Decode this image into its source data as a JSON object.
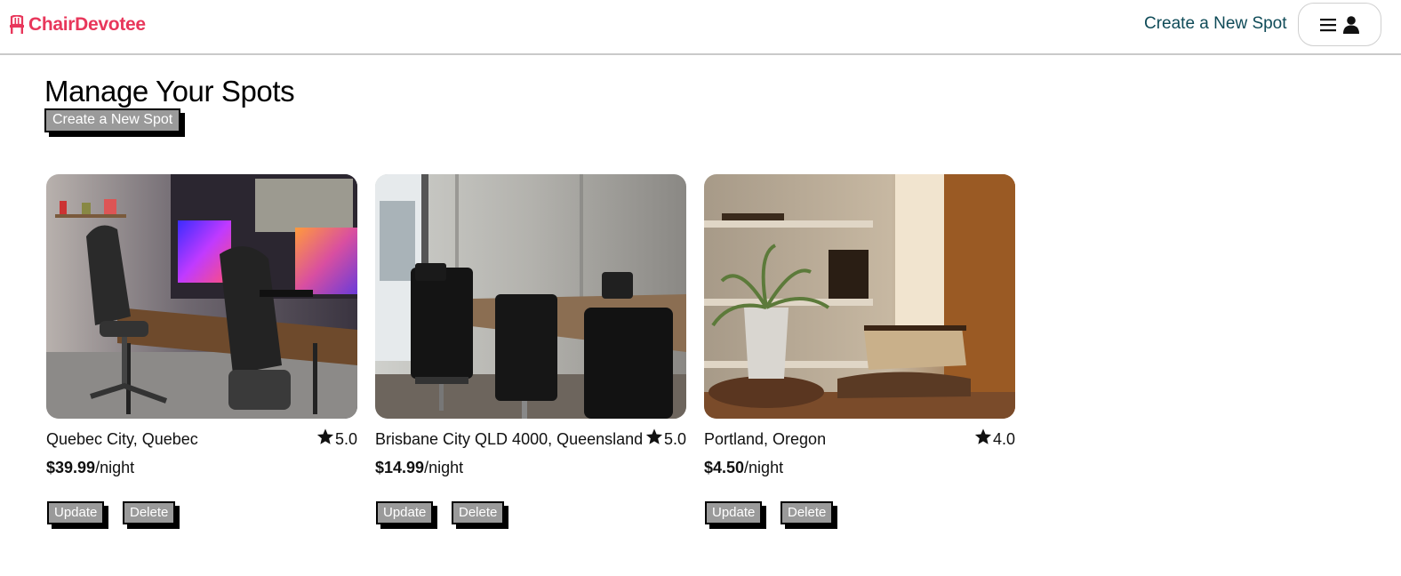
{
  "header": {
    "logo_text": "ChairDevotee",
    "create_spot_link": "Create a New Spot",
    "menu_icon": "hamburger-menu-icon",
    "user_icon": "user-icon"
  },
  "main": {
    "title": "Manage Your Spots",
    "create_button": "Create a New Spot"
  },
  "spots": [
    {
      "location": "Quebec City, Quebec",
      "rating": "5.0",
      "price": "$39.99",
      "price_suffix": "/night",
      "update_label": "Update",
      "delete_label": "Delete"
    },
    {
      "location": "Brisbane City QLD 4000, Queensland",
      "rating": "5.0",
      "price": "$14.99",
      "price_suffix": "/night",
      "update_label": "Update",
      "delete_label": "Delete"
    },
    {
      "location": "Portland, Oregon",
      "rating": "4.0",
      "price": "$4.50",
      "price_suffix": "/night",
      "update_label": "Update",
      "delete_label": "Delete"
    }
  ],
  "colors": {
    "brand": "#e8375b",
    "nav_link": "#0f4b58",
    "button_bg": "#9a9a9a"
  }
}
